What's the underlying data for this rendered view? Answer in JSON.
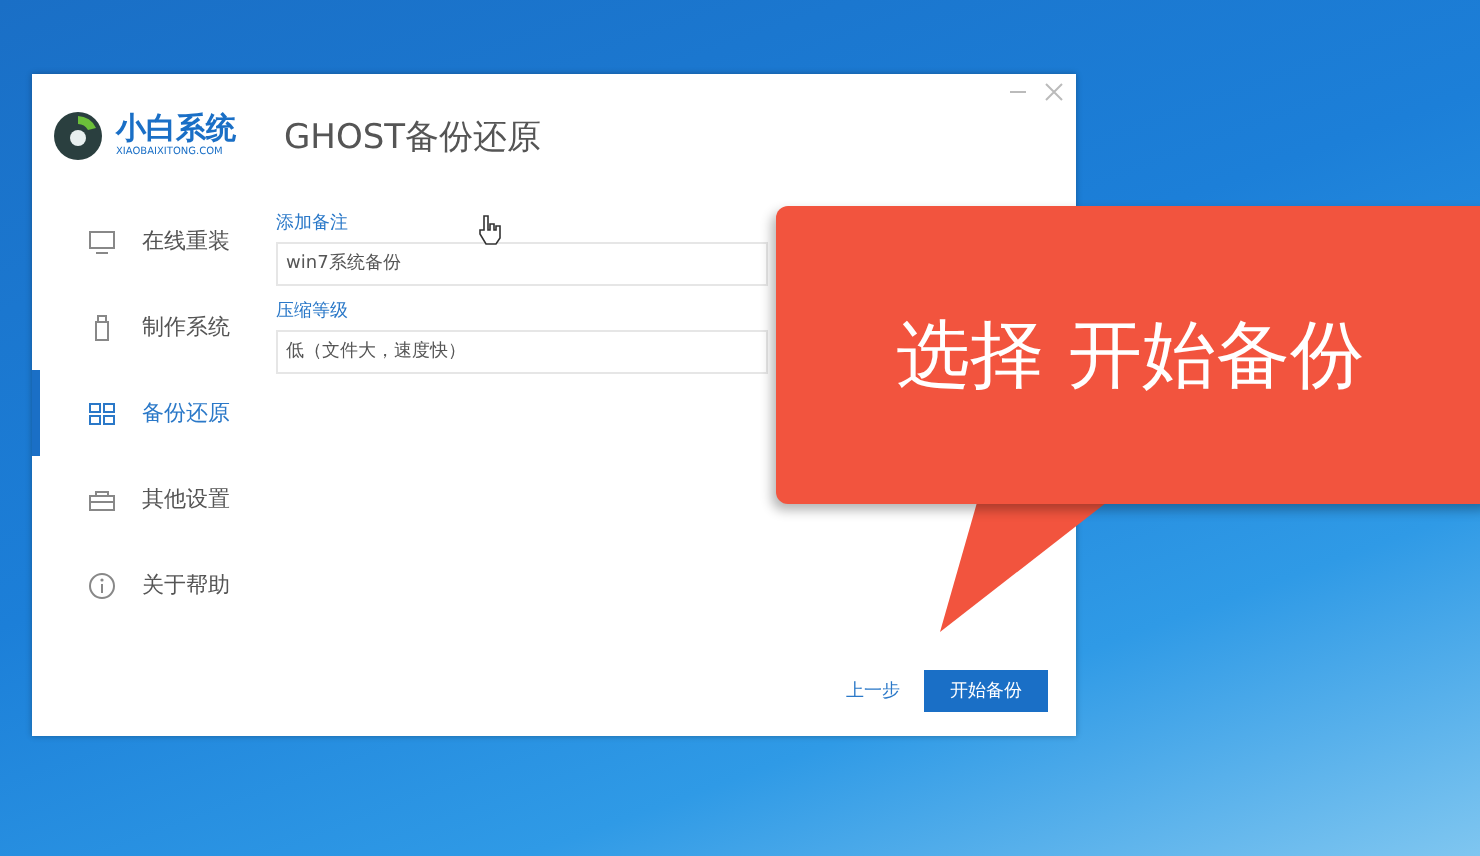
{
  "window": {
    "title": "GHOST备份还原",
    "logo_text": "小白系统",
    "logo_subtext": "XIAOBAIXITONG.COM"
  },
  "sidebar": {
    "items": [
      {
        "label": "在线重装",
        "kind": "monitor",
        "selected": false
      },
      {
        "label": "制作系统",
        "kind": "usb",
        "selected": false
      },
      {
        "label": "备份还原",
        "kind": "grid",
        "selected": true
      },
      {
        "label": "其他设置",
        "kind": "box",
        "selected": false
      },
      {
        "label": "关于帮助",
        "kind": "info",
        "selected": false
      }
    ]
  },
  "form": {
    "fields": [
      {
        "label": "添加备注",
        "value": "win7系统备份"
      },
      {
        "label": "压缩等级",
        "value": "低（文件大，速度快）"
      }
    ]
  },
  "buttons": {
    "back": "上一步",
    "start": "开始备份"
  },
  "callout": {
    "text": "选择 开始备份"
  }
}
